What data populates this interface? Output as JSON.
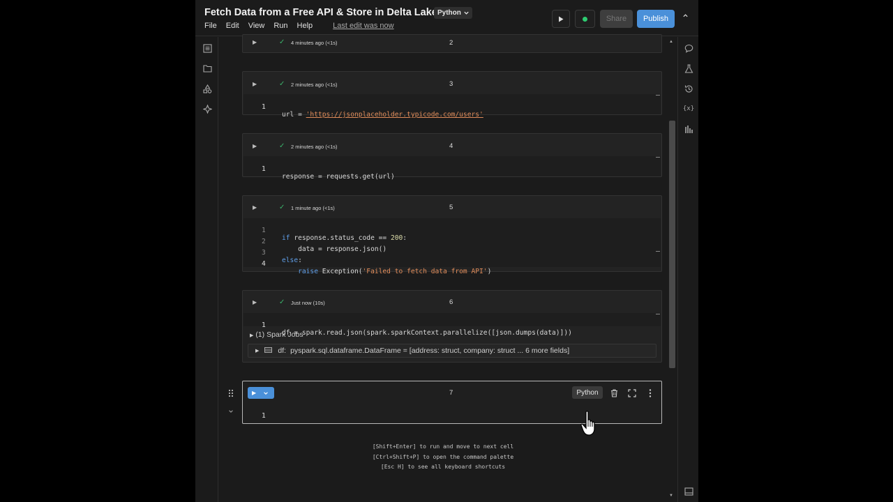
{
  "header": {
    "title": "Fetch Data from a Free API & Store in Delta Lake",
    "language": "Python",
    "menu": [
      "File",
      "Edit",
      "View",
      "Run",
      "Help"
    ],
    "last_edit": "Last edit was now",
    "share_label": "Share",
    "publish_label": "Publish"
  },
  "cells": [
    {
      "number": "2",
      "status": "4 minutes ago (<1s)"
    },
    {
      "number": "3",
      "status": "2 minutes ago (<1s)",
      "lines": [
        {
          "n": "1",
          "code_pre": "url = ",
          "code_str": "'https://jsonplaceholder.typicode.com/users'"
        }
      ]
    },
    {
      "number": "4",
      "status": "2 minutes ago (<1s)",
      "lines": [
        {
          "n": "1",
          "code": "response = requests.get(url)"
        }
      ]
    },
    {
      "number": "5",
      "status": "1 minute ago (<1s)",
      "lines": [
        {
          "n": "1",
          "kw": "if",
          "code": " response.status_code == ",
          "num": "200",
          "tail": ":"
        },
        {
          "n": "2",
          "code": "    data = response.json()"
        },
        {
          "n": "3",
          "kw": "else",
          "tail": ":"
        },
        {
          "n": "4",
          "kw": "    raise",
          "code": " Exception(",
          "str": "'Failed to fetch data from API'",
          "tail": ")"
        }
      ]
    },
    {
      "number": "6",
      "status": "Just now (10s)",
      "lines": [
        {
          "n": "1",
          "code": "df = spark.read.json(spark.sparkContext.parallelize([json.dumps(data)]))"
        }
      ],
      "spark_jobs": "(1) Spark Jobs",
      "df_name": "df:",
      "df_desc": "pyspark.sql.dataframe.DataFrame = [address: struct, company: struct ... 6 more fields]"
    },
    {
      "number": "7",
      "language": "Python",
      "lines": [
        {
          "n": "1",
          "code": ""
        }
      ]
    }
  ],
  "hints": [
    "[Shift+Enter] to run and move to next cell",
    "[Ctrl+Shift+P] to open the command palette",
    "[Esc H] to see all keyboard shortcuts"
  ]
}
